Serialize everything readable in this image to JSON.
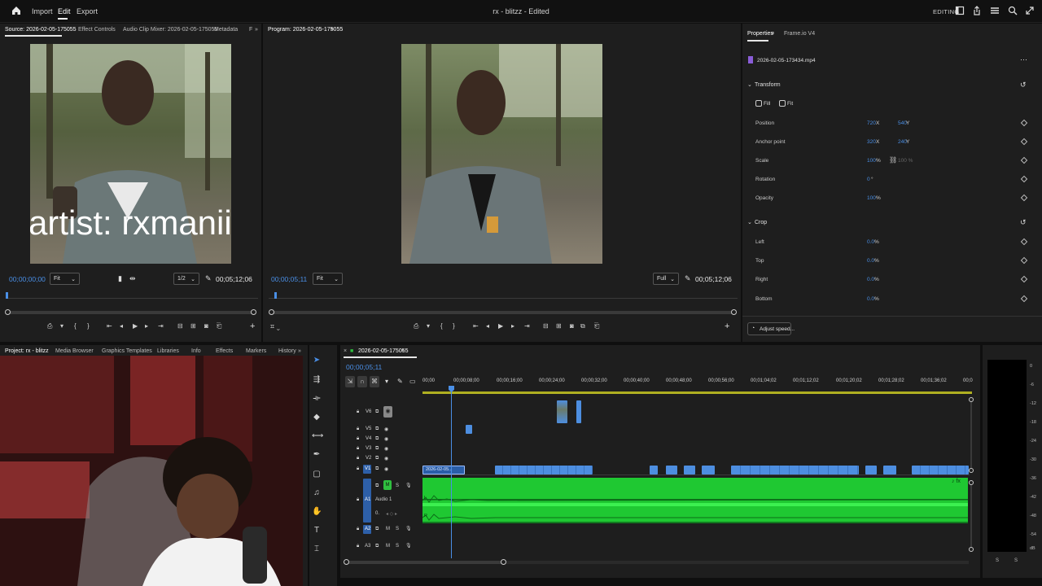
{
  "topbar": {
    "nav": [
      "Import",
      "Edit",
      "Export"
    ],
    "active_nav": "Edit",
    "doc_title": "rx - blitzz - Edited",
    "workspace": "EDITING"
  },
  "source": {
    "tabs": [
      "Source: 2026-02-05-175055",
      "Effect Controls",
      "Audio Clip Mixer: 2026-02-05-175055",
      "Metadata",
      "F",
      "»"
    ],
    "overlay_text": "artist: rxmanii",
    "timecode": "00;00;00;00",
    "fit": "Fit",
    "resolution": "1/2",
    "duration": "00;05;12;06"
  },
  "program": {
    "tab": "Program: 2026-02-05-175055",
    "timecode": "00;00;05;11",
    "fit": "Fit",
    "quality": "Full",
    "duration": "00;05;12;06"
  },
  "properties": {
    "tabs": [
      "Properties",
      "Frame.io V4"
    ],
    "filename": "2026-02-05-173434.mp4",
    "transform_title": "Transform",
    "fill_label": "Fill",
    "fit_label": "Fit",
    "rows": [
      {
        "label": "Position",
        "v1": "720",
        "u1": "X",
        "v2": "540",
        "u2": "Y"
      },
      {
        "label": "Anchor point",
        "v1": "320",
        "u1": "X",
        "v2": "240",
        "u2": "Y"
      },
      {
        "label": "Scale",
        "v1": "100",
        "u1": "%",
        "v2": "100 %",
        "u2": ""
      },
      {
        "label": "Rotation",
        "v1": "0",
        "u1": "°",
        "v2": "",
        "u2": ""
      },
      {
        "label": "Opacity",
        "v1": "100",
        "u1": "%",
        "v2": "",
        "u2": ""
      }
    ],
    "crop_title": "Crop",
    "crop_rows": [
      {
        "label": "Left",
        "v": "0.0",
        "u": "%"
      },
      {
        "label": "Top",
        "v": "0.0",
        "u": "%"
      },
      {
        "label": "Right",
        "v": "0.0",
        "u": "%"
      },
      {
        "label": "Bottom",
        "v": "0.0",
        "u": "%"
      }
    ],
    "adjust_speed": "Adjust speed..."
  },
  "project": {
    "tabs": [
      "Project: rx - blitzz",
      "Media Browser",
      "Graphics Templates",
      "Libraries",
      "Info",
      "Effects",
      "Markers",
      "History",
      "»"
    ]
  },
  "timeline": {
    "tab": "2026-02-05-175055",
    "timecode": "00;00;05;11",
    "ruler": [
      "00;00",
      "00;00;08;00",
      "00;00;16;00",
      "00;00;24;00",
      "00;00;32;00",
      "00;00;40;00",
      "00;00;48;00",
      "00;00;56;00",
      "00;01;04;02",
      "00;01;12;02",
      "00;01;20;02",
      "00;01;28;02",
      "00;01;36;02",
      "00;0"
    ],
    "video_tracks": [
      "V6",
      "V5",
      "V4",
      "V3",
      "V2",
      "V1"
    ],
    "audio_tracks": [
      "A1",
      "A2",
      "A3"
    ],
    "audio1_name": "Audio 1",
    "clip_label": "2026-02-05..",
    "audio_volume": "0.",
    "m_label": "M",
    "s_label": "S",
    "l_label": "L",
    "r_label": "R"
  },
  "meter": {
    "labels": [
      "0",
      "-6",
      "-12",
      "-18",
      "-24",
      "-30",
      "-36",
      "-42",
      "-48",
      "-54",
      "dB"
    ],
    "bottom": [
      "S",
      "S"
    ]
  },
  "colors": {
    "accent_blue": "#4a8fe6",
    "audio_green": "#1fc832",
    "clip_blue": "#4d8ee0"
  }
}
